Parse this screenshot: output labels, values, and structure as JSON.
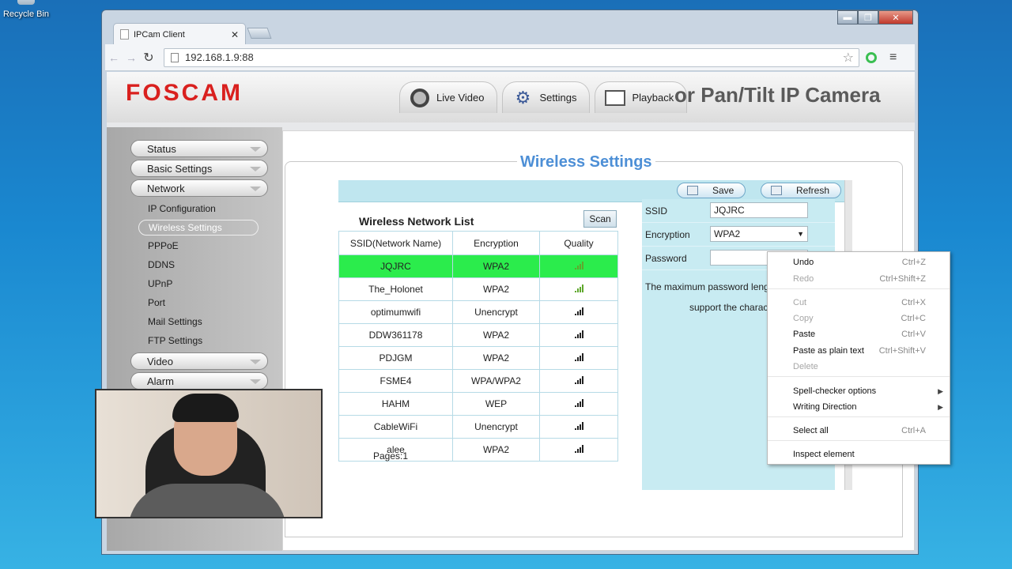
{
  "desktop": {
    "icon_label": "Recycle Bin"
  },
  "browser": {
    "tab_title": "IPCam Client",
    "url": "192.168.1.9:88",
    "window_buttons": {
      "minimize": "▬",
      "maximize": "❐",
      "close": "✕"
    }
  },
  "header": {
    "logo": "FOSCAM",
    "title_fragment": "or Pan/Tilt IP Camera",
    "nav": [
      {
        "label": "Live Video",
        "icon": "camera-icon"
      },
      {
        "label": "Settings",
        "icon": "gear-icon"
      },
      {
        "label": "Playback",
        "icon": "film-icon"
      }
    ]
  },
  "sidebar": {
    "main": [
      "Status",
      "Basic Settings",
      "Network",
      "Video",
      "Alarm"
    ],
    "network_sub": [
      "IP Configuration",
      "Wireless Settings",
      "PPPoE",
      "DDNS",
      "UPnP",
      "Port",
      "Mail Settings",
      "FTP Settings"
    ],
    "active": "Wireless Settings"
  },
  "main": {
    "title": "Wireless Settings",
    "save_label": "Save",
    "refresh_label": "Refresh",
    "list_title": "Wireless Network List",
    "scan_label": "Scan",
    "columns": [
      "SSID(Network Name)",
      "Encryption",
      "Quality"
    ],
    "networks": [
      {
        "ssid": "JQJRC",
        "enc": "WPA2",
        "quality": 4,
        "selected": true
      },
      {
        "ssid": "The_Holonet",
        "enc": "WPA2",
        "quality": 4
      },
      {
        "ssid": "optimumwifi",
        "enc": "Unencrypt",
        "quality": 4
      },
      {
        "ssid": "DDW361178",
        "enc": "WPA2",
        "quality": 4
      },
      {
        "ssid": "PDJGM",
        "enc": "WPA2",
        "quality": 4
      },
      {
        "ssid": "FSME4",
        "enc": "WPA/WPA2",
        "quality": 4
      },
      {
        "ssid": "HAHM",
        "enc": "WEP",
        "quality": 4
      },
      {
        "ssid": "CableWiFi",
        "enc": "Unencrypt",
        "quality": 4
      },
      {
        "ssid": "alee",
        "enc": "WPA2",
        "quality": 4
      }
    ],
    "pages": "Pages:1",
    "form": {
      "ssid_label": "SSID",
      "ssid_value": "JQJRC",
      "enc_label": "Encryption",
      "enc_value": "WPA2",
      "password_label": "Password",
      "password_value": "",
      "hint1": "The maximum password lengt",
      "hint2": "support the charact"
    }
  },
  "context_menu": {
    "items": [
      {
        "label": "Undo",
        "shortcut": "Ctrl+Z",
        "disabled": false
      },
      {
        "label": "Redo",
        "shortcut": "Ctrl+Shift+Z",
        "disabled": true
      },
      {
        "label": "Cut",
        "shortcut": "Ctrl+X",
        "disabled": true
      },
      {
        "label": "Copy",
        "shortcut": "Ctrl+C",
        "disabled": true
      },
      {
        "label": "Paste",
        "shortcut": "Ctrl+V",
        "disabled": false
      },
      {
        "label": "Paste as plain text",
        "shortcut": "Ctrl+Shift+V",
        "disabled": false
      },
      {
        "label": "Delete",
        "shortcut": "",
        "disabled": true
      },
      {
        "label": "Spell-checker options",
        "shortcut": "",
        "submenu": true
      },
      {
        "label": "Writing Direction",
        "shortcut": "",
        "submenu": true
      },
      {
        "label": "Select all",
        "shortcut": "Ctrl+A",
        "disabled": false
      },
      {
        "label": "Inspect element",
        "shortcut": "",
        "disabled": false
      }
    ]
  },
  "colors": {
    "selected_row": "#2bec4c",
    "title_blue": "#4d8fd6",
    "logo_red": "#d9201e"
  }
}
